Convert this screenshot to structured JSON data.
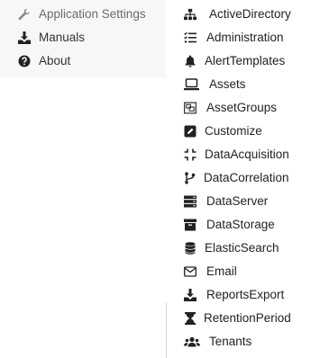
{
  "menu": {
    "items": [
      {
        "label": "Application Settings",
        "icon": "wrench-icon",
        "active": true
      },
      {
        "label": "Manuals",
        "icon": "download-icon"
      },
      {
        "label": "About",
        "icon": "question-circle-icon"
      }
    ]
  },
  "submenu": {
    "items": [
      {
        "label": "ActiveDirectory",
        "icon": "sitemap-icon"
      },
      {
        "label": "Administration",
        "icon": "tasks-icon"
      },
      {
        "label": "AlertTemplates",
        "icon": "bell-icon"
      },
      {
        "label": "Assets",
        "icon": "laptop-icon"
      },
      {
        "label": "AssetGroups",
        "icon": "object-group-icon"
      },
      {
        "label": "Customize",
        "icon": "edit-icon"
      },
      {
        "label": "DataAcquisition",
        "icon": "compress-icon"
      },
      {
        "label": "DataCorrelation",
        "icon": "code-branch-icon"
      },
      {
        "label": "DataServer",
        "icon": "server-icon"
      },
      {
        "label": "DataStorage",
        "icon": "archive-icon"
      },
      {
        "label": "ElasticSearch",
        "icon": "database-icon"
      },
      {
        "label": "Email",
        "icon": "envelope-icon"
      },
      {
        "label": "ReportsExport",
        "icon": "download-icon"
      },
      {
        "label": "RetentionPeriod",
        "icon": "hourglass-icon"
      },
      {
        "label": "Tenants",
        "icon": "users-icon"
      }
    ]
  },
  "colors": {
    "text": "#222222",
    "active_text": "#6b6b6b",
    "left_menu_bg": "#f7f7f7",
    "border": "#c9d3dd"
  }
}
